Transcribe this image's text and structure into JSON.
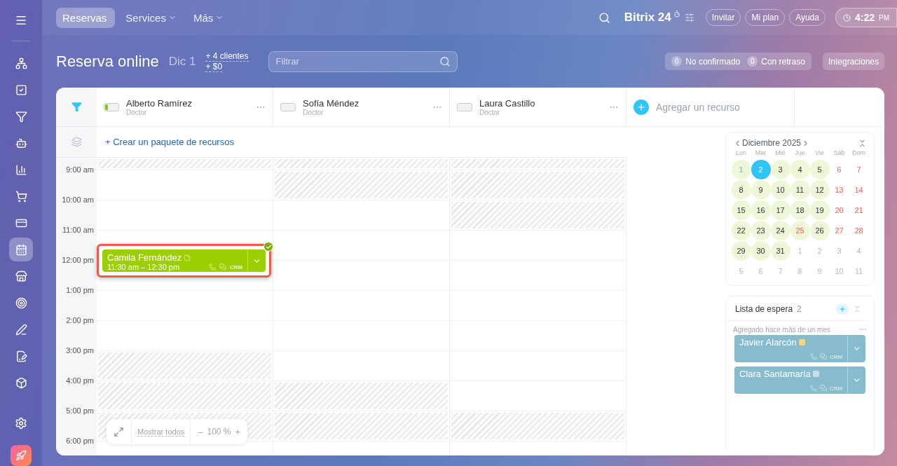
{
  "sidebar": {
    "items": [
      {
        "kind": "network",
        "selected": false
      },
      {
        "kind": "tasks",
        "selected": false
      },
      {
        "kind": "funnel",
        "selected": false
      },
      {
        "kind": "robot",
        "selected": false
      },
      {
        "kind": "chart",
        "selected": false
      },
      {
        "kind": "cart",
        "selected": false
      },
      {
        "kind": "card",
        "selected": false
      },
      {
        "kind": "calendar",
        "selected": true
      },
      {
        "kind": "store",
        "selected": false
      },
      {
        "kind": "target",
        "selected": false
      },
      {
        "kind": "pen",
        "selected": false
      },
      {
        "kind": "sign",
        "selected": false
      },
      {
        "kind": "box",
        "selected": false
      }
    ]
  },
  "top_tabs": [
    {
      "label": "Reservas",
      "selected": true,
      "dropdown": false
    },
    {
      "label": "Services",
      "selected": false,
      "dropdown": true
    },
    {
      "label": "Más",
      "selected": false,
      "dropdown": true
    }
  ],
  "brand": {
    "name": "Bitrix",
    "number": "24"
  },
  "top_buttons": [
    "Invitar",
    "Mi plan",
    "Ayuda"
  ],
  "clock": {
    "time": "4:22",
    "period": "PM"
  },
  "page": {
    "title": "Reserva online",
    "date": "Dic 1",
    "clients": "+ 4 clientes",
    "revenue": "+ $0",
    "filter_placeholder": "Filtrar"
  },
  "counters": [
    {
      "count": "0",
      "label": "No confirmado"
    },
    {
      "count": "0",
      "label": "Con retraso"
    }
  ],
  "integrations": "Integraciones",
  "resources": [
    {
      "name": "Alberto Ramírez",
      "role": "Doctor",
      "level": 0.2,
      "slots": [
        {
          "blocked": true
        },
        {
          "blocked": false
        },
        {
          "blocked": false
        },
        {
          "blocked": false,
          "booking": {
            "name": "Camila Fernández",
            "time": "11:30 am – 12:30 pm",
            "crm": "CRM",
            "confirmed": true,
            "selected": true
          }
        },
        {
          "blocked": false
        },
        {
          "blocked": false
        },
        {
          "blocked": false
        },
        {
          "blocked": true
        },
        {
          "blocked": true
        },
        {
          "blocked": true
        }
      ]
    },
    {
      "name": "Sofía Méndez",
      "role": "Doctor",
      "level": 0,
      "slots": [
        {
          "blocked": true
        },
        {
          "blocked": true
        },
        {
          "blocked": false
        },
        {
          "blocked": false
        },
        {
          "blocked": false
        },
        {
          "blocked": false
        },
        {
          "blocked": false
        },
        {
          "blocked": false
        },
        {
          "blocked": true
        },
        {
          "blocked": true
        }
      ]
    },
    {
      "name": "Laura Castillo",
      "role": "Doctor",
      "level": 0,
      "slots": [
        {
          "blocked": true
        },
        {
          "blocked": true
        },
        {
          "blocked": true
        },
        {
          "blocked": false
        },
        {
          "blocked": false
        },
        {
          "blocked": false
        },
        {
          "blocked": false
        },
        {
          "blocked": false
        },
        {
          "blocked": false
        },
        {
          "blocked": true
        }
      ]
    }
  ],
  "add_resource": "Agregar un recurso",
  "create_package": "+ Crear un paquete de recursos",
  "hours": [
    "9:00 am",
    "10:00 am",
    "11:00 am",
    "12:00 pm",
    "1:00 pm",
    "2:00 pm",
    "3:00 pm",
    "4:00 pm",
    "5:00 pm",
    "6:00 pm"
  ],
  "zoom_bar": {
    "show_all": "Mostrar todos",
    "minus": "–",
    "value": "100 %",
    "plus": "+"
  },
  "calendar": {
    "month": "Diciembre 2025",
    "weekdays": [
      "Lun",
      "Mar",
      "Mié",
      "Jue",
      "Vie",
      "Sáb",
      "Dom"
    ],
    "days": [
      {
        "d": "1",
        "kind": "today",
        "selected": false
      },
      {
        "d": "2",
        "kind": "work",
        "selected": true
      },
      {
        "d": "3",
        "kind": "work",
        "selected": false
      },
      {
        "d": "4",
        "kind": "work",
        "selected": false
      },
      {
        "d": "5",
        "kind": "work",
        "selected": false
      },
      {
        "d": "6",
        "kind": "weekend",
        "selected": false
      },
      {
        "d": "7",
        "kind": "weekend",
        "selected": false
      },
      {
        "d": "8",
        "kind": "work",
        "selected": false
      },
      {
        "d": "9",
        "kind": "work",
        "selected": false
      },
      {
        "d": "10",
        "kind": "work",
        "selected": false
      },
      {
        "d": "11",
        "kind": "work",
        "selected": false
      },
      {
        "d": "12",
        "kind": "work",
        "selected": false
      },
      {
        "d": "13",
        "kind": "weekend",
        "selected": false
      },
      {
        "d": "14",
        "kind": "weekend",
        "selected": false
      },
      {
        "d": "15",
        "kind": "work",
        "selected": false
      },
      {
        "d": "16",
        "kind": "work",
        "selected": false
      },
      {
        "d": "17",
        "kind": "work",
        "selected": false
      },
      {
        "d": "18",
        "kind": "work",
        "selected": false
      },
      {
        "d": "19",
        "kind": "work",
        "selected": false
      },
      {
        "d": "20",
        "kind": "weekend",
        "selected": false
      },
      {
        "d": "21",
        "kind": "weekend",
        "selected": false
      },
      {
        "d": "22",
        "kind": "work",
        "selected": false
      },
      {
        "d": "23",
        "kind": "work",
        "selected": false
      },
      {
        "d": "24",
        "kind": "work",
        "selected": false
      },
      {
        "d": "25",
        "kind": "holiday",
        "selected": false
      },
      {
        "d": "26",
        "kind": "work",
        "selected": false
      },
      {
        "d": "27",
        "kind": "weekend",
        "selected": false
      },
      {
        "d": "28",
        "kind": "weekend",
        "selected": false
      },
      {
        "d": "29",
        "kind": "work",
        "selected": false
      },
      {
        "d": "30",
        "kind": "work",
        "selected": false
      },
      {
        "d": "31",
        "kind": "work",
        "selected": false
      },
      {
        "d": "1",
        "kind": "other",
        "selected": false
      },
      {
        "d": "2",
        "kind": "other",
        "selected": false
      },
      {
        "d": "3",
        "kind": "other",
        "selected": false
      },
      {
        "d": "4",
        "kind": "other",
        "selected": false
      },
      {
        "d": "5",
        "kind": "other",
        "selected": false
      },
      {
        "d": "6",
        "kind": "other",
        "selected": false
      },
      {
        "d": "7",
        "kind": "other",
        "selected": false
      },
      {
        "d": "8",
        "kind": "other",
        "selected": false
      },
      {
        "d": "9",
        "kind": "other",
        "selected": false
      },
      {
        "d": "10",
        "kind": "other",
        "selected": false
      },
      {
        "d": "11",
        "kind": "other",
        "selected": false
      }
    ]
  },
  "waitlist": {
    "title": "Lista de espera",
    "count": "2",
    "group": "Agregado hace más de un mes",
    "items": [
      {
        "name": "Javier Alarcón",
        "crm": "CRM",
        "color": "#f5d67a"
      },
      {
        "name": "Clara Santamaría",
        "crm": "CRM",
        "color": "#c9dde6"
      }
    ]
  }
}
